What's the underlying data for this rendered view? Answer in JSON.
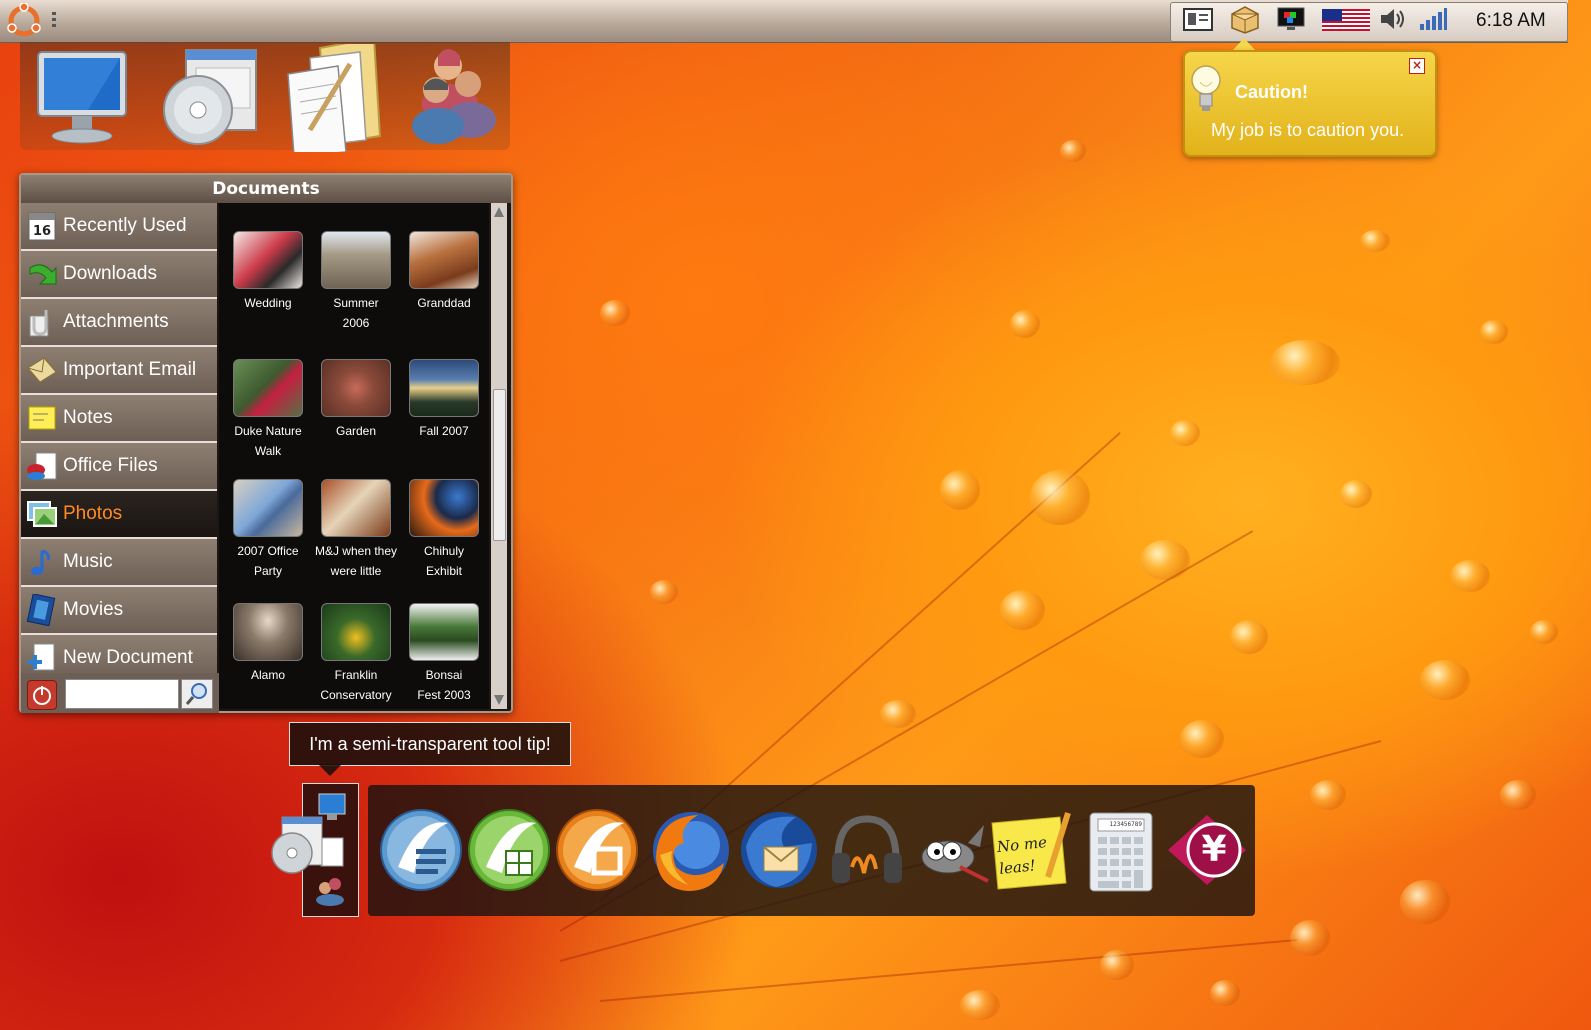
{
  "system": {
    "clock": "6:18 AM"
  },
  "documents_window": {
    "title": "Documents",
    "sidebar": [
      {
        "label": "Recently Used",
        "icon": "calendar-icon",
        "active": false
      },
      {
        "label": "Downloads",
        "icon": "downloads-arrow-icon",
        "active": false
      },
      {
        "label": "Attachments",
        "icon": "paperclip-icon",
        "active": false
      },
      {
        "label": "Important Email",
        "icon": "envelope-icon",
        "active": false
      },
      {
        "label": "Notes",
        "icon": "sticky-note-icon",
        "active": false
      },
      {
        "label": "Office Files",
        "icon": "office-files-icon",
        "active": false
      },
      {
        "label": "Photos",
        "icon": "photos-icon",
        "active": true
      },
      {
        "label": "Music",
        "icon": "music-note-icon",
        "active": false
      },
      {
        "label": "Movies",
        "icon": "film-strip-icon",
        "active": false
      },
      {
        "label": "New Document",
        "icon": "new-document-icon",
        "active": false
      }
    ],
    "search_placeholder": "",
    "photos": [
      {
        "line1": "Wedding",
        "line2": ""
      },
      {
        "line1": "Summer",
        "line2": "2006"
      },
      {
        "line1": "Granddad",
        "line2": ""
      },
      {
        "line1": "Duke Nature",
        "line2": "Walk"
      },
      {
        "line1": "Garden",
        "line2": ""
      },
      {
        "line1": "Fall 2007",
        "line2": ""
      },
      {
        "line1": "2007 Office",
        "line2": "Party"
      },
      {
        "line1": "M&J when they",
        "line2": "were little"
      },
      {
        "line1": "Chihuly",
        "line2": "Exhibit"
      },
      {
        "line1": "Alamo",
        "line2": ""
      },
      {
        "line1": "Franklin",
        "line2": "Conservatory"
      },
      {
        "line1": "Bonsai",
        "line2": "Fest 2003"
      }
    ]
  },
  "notification": {
    "title": "Caution!",
    "message": "My job is to caution you.",
    "close_label": "×"
  },
  "tooltip": {
    "text": "I'm a semi-transparent tool tip!"
  },
  "dock": {
    "items": [
      {
        "name": "writer-icon"
      },
      {
        "name": "calc-spreadsheet-icon"
      },
      {
        "name": "impress-presentation-icon"
      },
      {
        "name": "firefox-icon"
      },
      {
        "name": "thunderbird-icon"
      },
      {
        "name": "audio-headphones-icon"
      },
      {
        "name": "gimp-icon"
      },
      {
        "name": "sticky-notes-icon"
      },
      {
        "name": "calculator-icon"
      },
      {
        "name": "finance-yen-icon"
      }
    ],
    "sticky_text": "No me leas!",
    "calculator_display": "123456789",
    "finance_symbol": "¥"
  },
  "colors": {
    "active_sidebar_text": "#ff8a22",
    "caution_bg": "#f6d64a",
    "panel_bg": "#b9aa9c"
  }
}
